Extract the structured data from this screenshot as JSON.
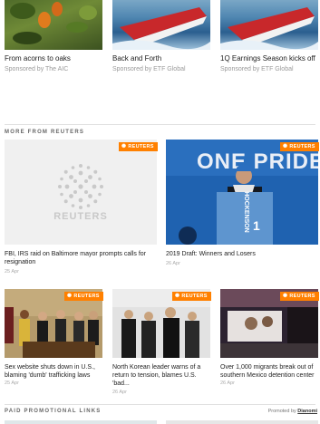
{
  "sponsored": [
    {
      "title": "From acorns to oaks",
      "sponsor": "Sponsored by The AIC"
    },
    {
      "title": "Back and Forth",
      "sponsor": "Sponsored by ETF Global"
    },
    {
      "title": "1Q Earnings Season kicks off",
      "sponsor": "Sponsored by ETF Global"
    }
  ],
  "more_from": {
    "label": "MORE FROM REUTERS",
    "tag": "REUTERS",
    "logo_text": "REUTERS",
    "featured": [
      {
        "caption": "FBI, IRS raid on Baltimore mayor prompts calls for resignation",
        "date": "25 Apr"
      },
      {
        "caption": "2019 Draft: Winners and Losers",
        "date": "26 Apr",
        "banner_text": "ONE PRIDE",
        "jersey_name": "HOCKENSON",
        "jersey_number": "1"
      }
    ],
    "small": [
      {
        "caption": "Sex website shuts down in U.S., blaming 'dumb' trafficking laws",
        "date": "25 Apr"
      },
      {
        "caption": "North Korean leader warns of a return to tension, blames U.S. 'bad...",
        "date": "26 Apr"
      },
      {
        "caption": "Over 1,000 migrants break out of southern Mexico detention center",
        "date": "26 Apr"
      }
    ]
  },
  "promo": {
    "label": "PAID PROMOTIONAL LINKS",
    "powered_prefix": "Promoted by",
    "powered_brand": "Dianomi"
  }
}
